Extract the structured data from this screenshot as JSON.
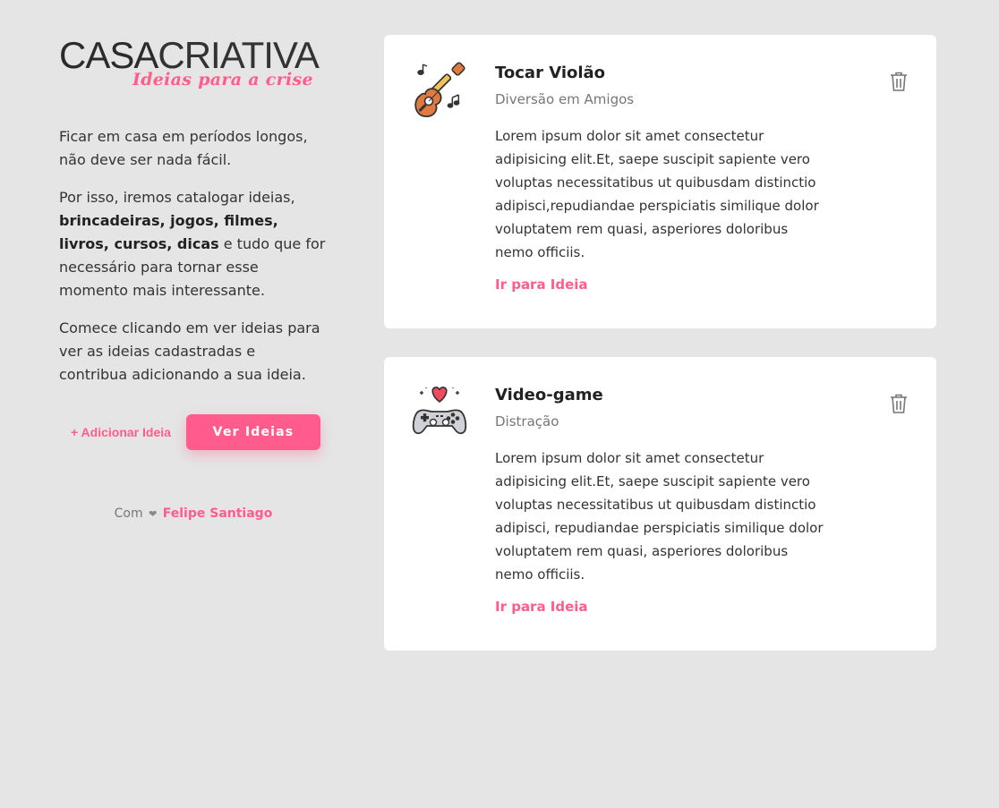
{
  "logo": {
    "part1": "CASA",
    "part2": "CRIATIVA",
    "tagline": "Ideias para a crise"
  },
  "intro": {
    "p1": "Ficar em casa em períodos longos, não deve ser nada fácil.",
    "p2_before": "Por isso, iremos catalogar ideias, ",
    "p2_bold": "brincadeiras, jogos, filmes, livros, cursos, dicas",
    "p2_after": " e tudo que for necessário para tornar esse momento mais interessante.",
    "p3": "Comece clicando em ver ideias para ver as ideias cadastradas e contribua adicionando a sua ideia."
  },
  "actions": {
    "add_label": "+ Adicionar Ideia",
    "view_label": "Ver Ideias"
  },
  "credit": {
    "prefix": "Com",
    "heart": "❤",
    "author": "Felipe Santiago"
  },
  "cards": [
    {
      "icon": "guitar-icon",
      "title": "Tocar Violão",
      "category": "Diversão em Amigos",
      "description": "Lorem ipsum dolor sit amet consectetur adipisicing elit.Et, saepe suscipit sapiente vero voluptas necessitatibus ut quibusdam distinctio adipisci,repudiandae perspiciatis similique dolor voluptatem rem quasi, asperiores doloribus nemo officiis.",
      "link": "Ir para Ideia",
      "delete_icon": "trash-icon"
    },
    {
      "icon": "gamepad-icon",
      "title": "Video-game",
      "category": "Distração",
      "description": "Lorem ipsum dolor sit amet consectetur adipisicing elit.Et, saepe suscipit sapiente vero voluptas necessitatibus ut quibusdam distinctio adipisci, repudiandae perspiciatis similique dolor voluptatem rem quasi, asperiores doloribus nemo officiis.",
      "link": "Ir para Ideia",
      "delete_icon": "trash-icon"
    }
  ],
  "colors": {
    "background": "#e5e5e5",
    "accent": "#ff5c8d",
    "card": "#ffffff",
    "text": "#2b2b2b",
    "muted": "#777777"
  }
}
